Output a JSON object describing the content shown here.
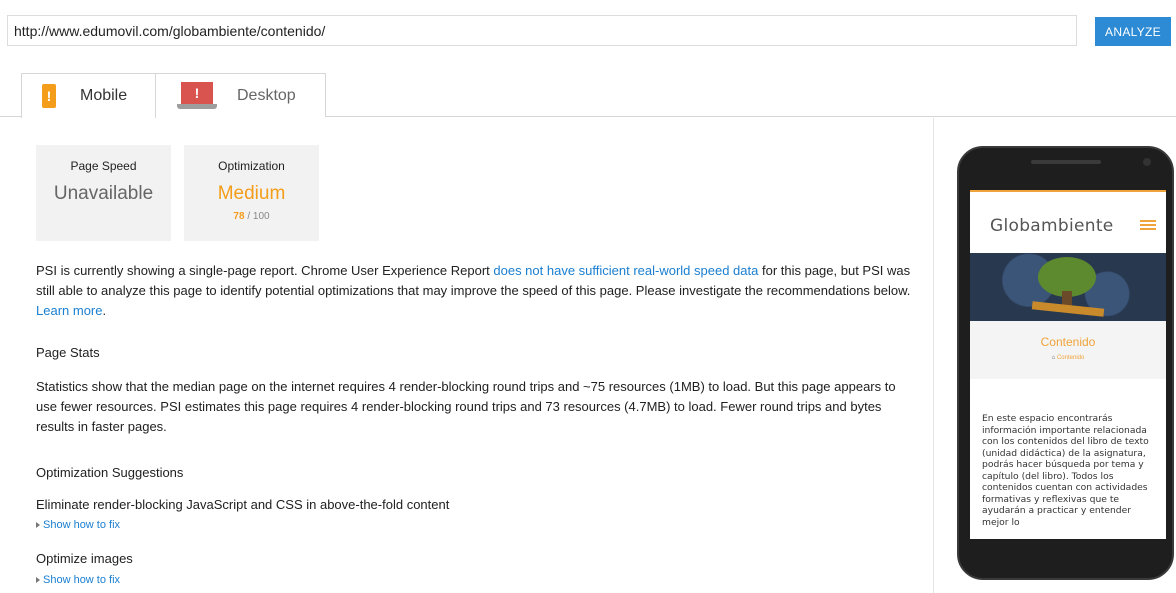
{
  "url_bar": {
    "value": "http://www.edumovil.com/globambiente/contenido/"
  },
  "analyze_button": {
    "label": "ANALYZE"
  },
  "tabs": [
    {
      "label": "Mobile",
      "icon": "mobile-warning-icon",
      "active": true
    },
    {
      "label": "Desktop",
      "icon": "desktop-warning-icon",
      "active": false
    }
  ],
  "scores": {
    "page_speed": {
      "title": "Page Speed",
      "value": "Unavailable"
    },
    "optimization": {
      "title": "Optimization",
      "value": "Medium",
      "score": "78",
      "max": "/ 100"
    }
  },
  "intro": {
    "text1": "PSI is currently showing a single-page report. Chrome User Experience Report ",
    "link1": "does not have sufficient real-world speed data",
    "text2": " for this page, but PSI was still able to analyze this page to identify potential optimizations that may improve the speed of this page. Please investigate the recommendations below. ",
    "link2": "Learn more",
    "text3": "."
  },
  "page_stats": {
    "heading": "Page Stats",
    "text": "Statistics show that the median page on the internet requires 4 render-blocking round trips and ~75 resources (1MB) to load. But this page appears to use fewer resources. PSI estimates this page requires 4 render-blocking round trips and 73 resources (4.7MB) to load. Fewer round trips and bytes results in faster pages."
  },
  "optimization_suggestions": {
    "heading": "Optimization Suggestions",
    "items": [
      {
        "title": "Eliminate render-blocking JavaScript and CSS in above-the-fold content",
        "fix_label": "Show how to fix"
      },
      {
        "title": "Optimize images",
        "fix_label": "Show how to fix"
      }
    ]
  },
  "preview": {
    "logo": "Globambiente",
    "page_title": "Contenido",
    "breadcrumb_home": "⌂",
    "breadcrumb": "Contenido",
    "body": "En este espacio encontrarás información importante relacionada con los contenidos del libro de texto (unidad didáctica) de la asignatura, podrás hacer búsqueda por tema y capítulo (del libro). Todos los contenidos cuentan con actividades formativas y reflexivas que te ayudarán a practicar y entender mejor lo",
    "colors": {
      "accent": "#f0a33a"
    }
  },
  "colors": {
    "primary": "#2c8bd4",
    "warning": "#f49d1b",
    "error": "#d9534f",
    "link": "#1a7fd0"
  }
}
